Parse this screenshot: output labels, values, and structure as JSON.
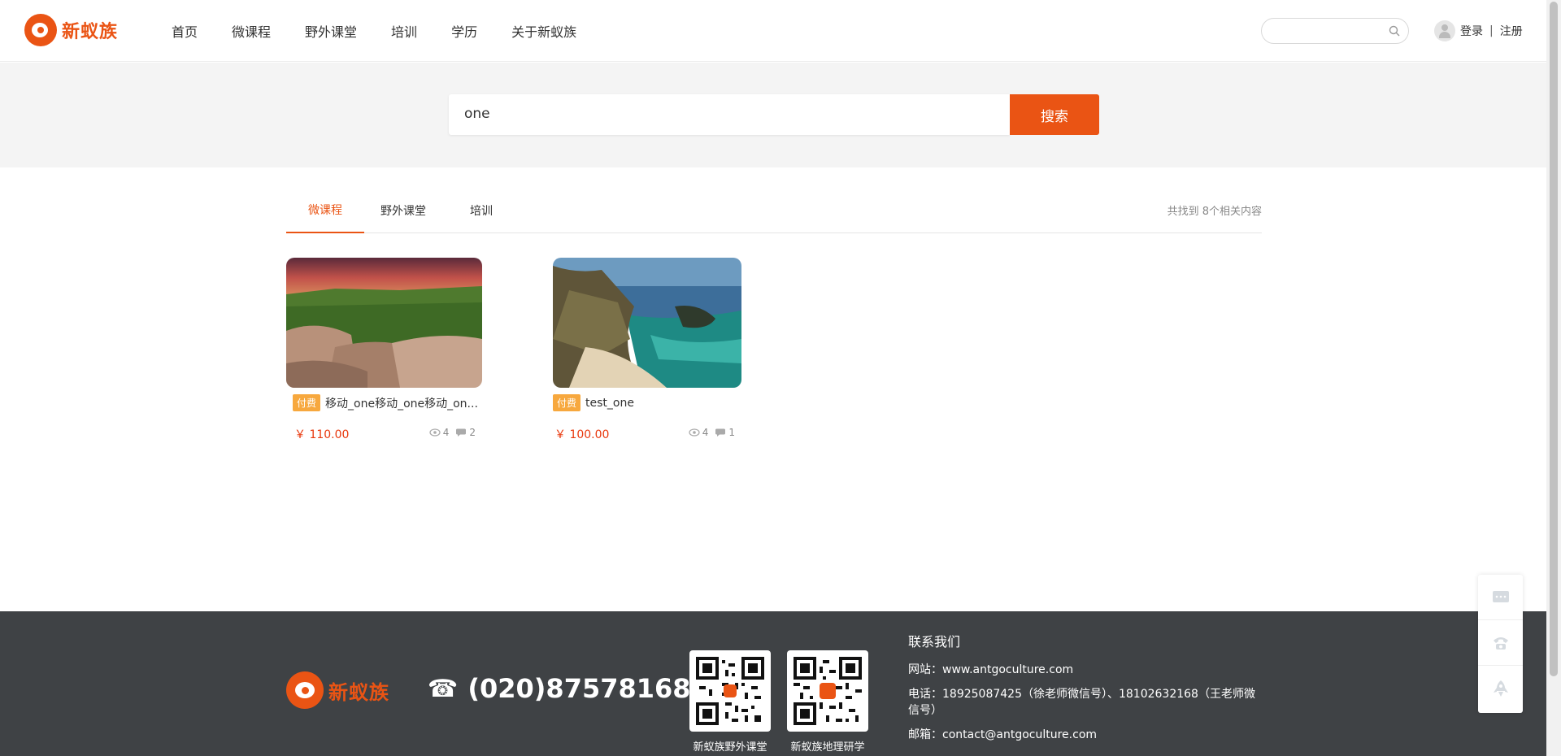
{
  "header": {
    "logo_text": "新蚁族",
    "nav": [
      "首页",
      "微课程",
      "野外课堂",
      "培训",
      "学历",
      "关于新蚁族"
    ],
    "search_placeholder": "",
    "login": "登录",
    "separator": "|",
    "register": "注册"
  },
  "search": {
    "query": "one",
    "button": "搜索"
  },
  "tabs": {
    "items": [
      "微课程",
      "野外课堂",
      "培训"
    ],
    "active": "微课程",
    "result_count": "共找到 8个相关内容"
  },
  "courses": [
    {
      "badge": "付费",
      "title": "移动_one移动_one移动_on...",
      "price": "￥ 110.00",
      "views": "4",
      "comments": "2"
    },
    {
      "badge": "付费",
      "title": "test_one",
      "price": "￥ 100.00",
      "views": "4",
      "comments": "1"
    }
  ],
  "footer": {
    "logo_text": "新蚁族",
    "phone": "(020)87578168",
    "qrcodes": [
      "新蚁族野外课堂",
      "新蚁族地理研学"
    ],
    "contact_title": "联系我们",
    "website": "网站：www.antgoculture.com",
    "tel": "电话：18925087425（徐老师微信号）、18102632168（王老师微信号）",
    "email": "邮箱：contact@antgoculture.com"
  },
  "colors": {
    "brand": "#ea5414",
    "price": "#e8380d",
    "badge": "#f7a83e",
    "footer_bg": "#3f4245"
  }
}
